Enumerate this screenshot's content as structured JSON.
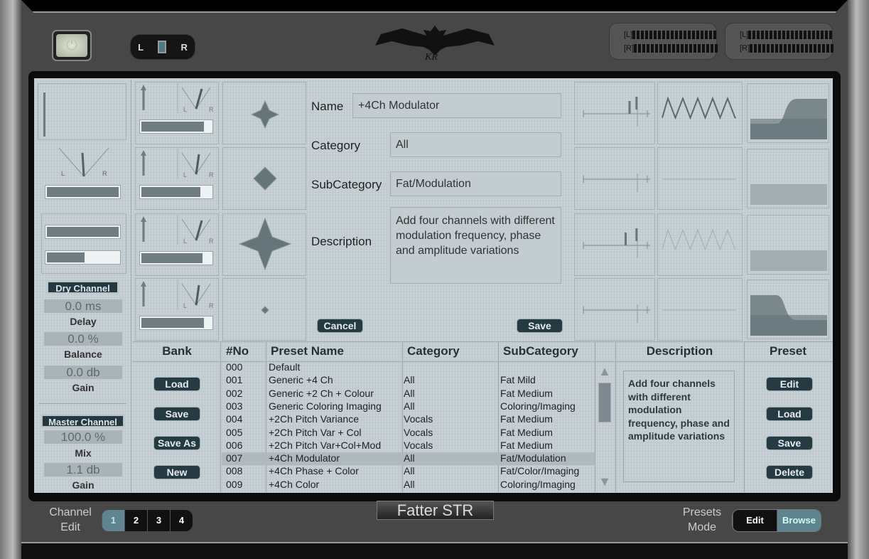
{
  "header": {
    "lr_left": "L",
    "lr_right": "R",
    "meter_labels": [
      "[L]",
      "[R]"
    ],
    "logo_text": "KR"
  },
  "left": {
    "dry_channel": "Dry Channel",
    "delay_value": "0.0 ms",
    "delay_label": "Delay",
    "balance_value": "0.0 %",
    "balance_label": "Balance",
    "gain_value": "0.0 db",
    "gain_label": "Gain",
    "master_channel": "Master Channel",
    "mix_value": "100.0 %",
    "mix_label": "Mix",
    "master_gain_value": "1.1 db",
    "master_gain_label": "Gain",
    "gauge_l": "L",
    "gauge_r": "R"
  },
  "editor": {
    "name_label": "Name",
    "name_value": "+4Ch Modulator",
    "category_label": "Category",
    "category_value": "All",
    "subcategory_label": "SubCategory",
    "subcategory_value": "Fat/Modulation",
    "description_label": "Description",
    "description_value": "Add four channels with different modulation frequency, phase and amplitude variations",
    "cancel": "Cancel",
    "save": "Save"
  },
  "table": {
    "headers": {
      "bank": "Bank",
      "no": "#No",
      "name": "Preset Name",
      "category": "Category",
      "subcategory": "SubCategory",
      "description": "Description",
      "preset": "Preset"
    },
    "rows": [
      {
        "no": "000",
        "name": "Default",
        "category": "",
        "subcategory": ""
      },
      {
        "no": "001",
        "name": "Generic +4 Ch",
        "category": "All",
        "subcategory": "Fat Mild"
      },
      {
        "no": "002",
        "name": "Generic +2 Ch + Colour",
        "category": "All",
        "subcategory": "Fat Medium"
      },
      {
        "no": "003",
        "name": "Generic Coloring Imaging",
        "category": "All",
        "subcategory": "Coloring/Imaging"
      },
      {
        "no": "004",
        "name": "+2Ch Pitch Variance",
        "category": "Vocals",
        "subcategory": "Fat Medium"
      },
      {
        "no": "005",
        "name": "+2Ch Pitch Var + Col",
        "category": "Vocals",
        "subcategory": "Fat Medium"
      },
      {
        "no": "006",
        "name": "+2Ch Pitch Var+Col+Mod",
        "category": "Vocals",
        "subcategory": "Fat Medium"
      },
      {
        "no": "007",
        "name": "+4Ch Modulator",
        "category": "All",
        "subcategory": "Fat/Modulation",
        "selected": true
      },
      {
        "no": "008",
        "name": "+4Ch Phase + Color",
        "category": "All",
        "subcategory": "Fat/Color/Imaging"
      },
      {
        "no": "009",
        "name": "+4Ch Color",
        "category": "All",
        "subcategory": "Coloring/Imaging"
      }
    ],
    "description": "Add four channels with different modulation frequency, phase and amplitude variations",
    "bank_buttons": [
      "Load",
      "Save",
      "Save As",
      "New"
    ],
    "preset_buttons": [
      "Edit",
      "Load",
      "Save",
      "Delete"
    ]
  },
  "footer": {
    "channel_edit": "Channel Edit",
    "channels": [
      "1",
      "2",
      "3",
      "4"
    ],
    "active_channel": "1",
    "product": "Fatter STR",
    "presets_mode": "Presets Mode",
    "mode_edit": "Edit",
    "mode_browse": "Browse",
    "active_mode": "Browse"
  },
  "colors": {
    "screen_bg": "#c8d1d5",
    "button_dark": "#253a42",
    "accent_teal": "#5f8591"
  }
}
